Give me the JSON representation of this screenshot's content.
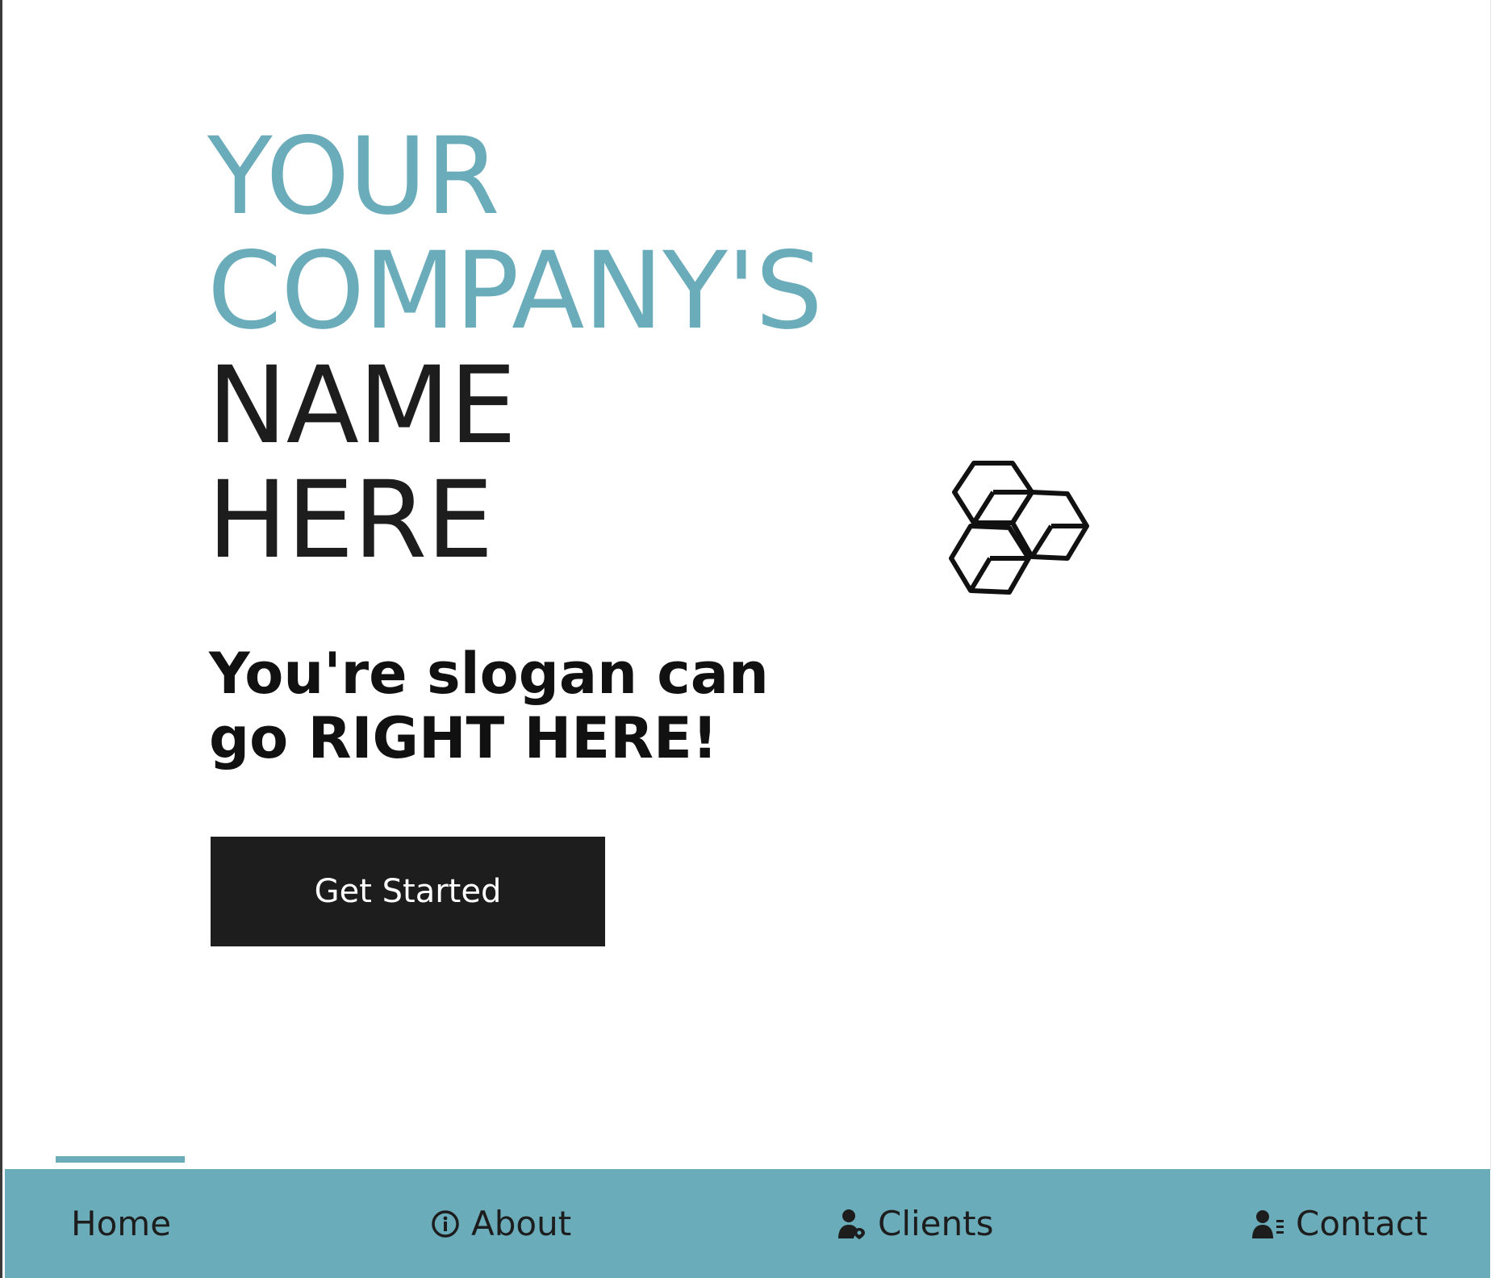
{
  "hero": {
    "title_line1": "YOUR",
    "title_line2": "COMPANY'S",
    "title_line3": "NAME",
    "title_line4": "HERE",
    "slogan": "You're slogan can go RIGHT HERE!",
    "cta_label": "Get Started",
    "logo_icon": "cubes-icon"
  },
  "nav": {
    "items": [
      {
        "label": "Home",
        "icon": "",
        "active": true
      },
      {
        "label": "About",
        "icon": "info-circle-icon",
        "active": false
      },
      {
        "label": "Clients",
        "icon": "user-location-icon",
        "active": false
      },
      {
        "label": "Contact",
        "icon": "user-list-icon",
        "active": false
      }
    ]
  },
  "colors": {
    "accent": "#6aacba",
    "dark": "#1d1d1d",
    "background": "#ffffff"
  }
}
